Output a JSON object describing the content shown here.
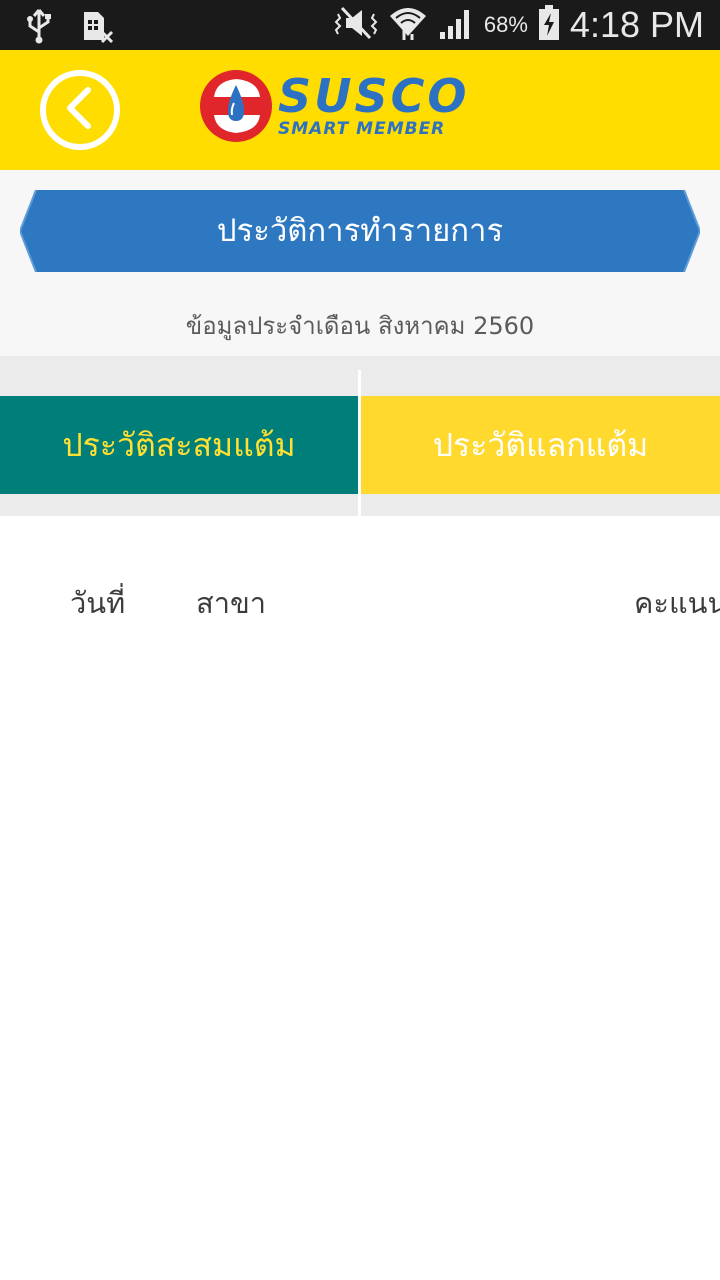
{
  "status_bar": {
    "battery_percent": "68%",
    "time": "4:18 PM",
    "icons": [
      "usb-icon",
      "sim-card-icon",
      "vibrate-silent-icon",
      "wifi-icon",
      "signal-icon",
      "battery-charging-icon"
    ]
  },
  "header": {
    "back_icon": "chevron-left-icon",
    "logo_text": "SUSCO",
    "logo_subtext": "SMART MEMBER",
    "logo_colors": {
      "red": "#e0262a",
      "blue": "#2d72c2"
    }
  },
  "page": {
    "title": "ประวัติการทำรายการ",
    "month_info": "ข้อมูลประจำเดือน สิงหาคม 2560"
  },
  "tabs": [
    {
      "label": "ประวัติสะสมแต้ม",
      "selected": true
    },
    {
      "label": "ประวัติแลกแต้ม",
      "selected": false
    }
  ],
  "table": {
    "columns": [
      "วันที่",
      "สาขา",
      "คะแนน"
    ],
    "rows": []
  },
  "colors": {
    "header_yellow": "#ffdd00",
    "ribbon_blue": "#2d78c1",
    "tab_teal": "#007f7a",
    "tab_yellow": "#ffd92e"
  }
}
